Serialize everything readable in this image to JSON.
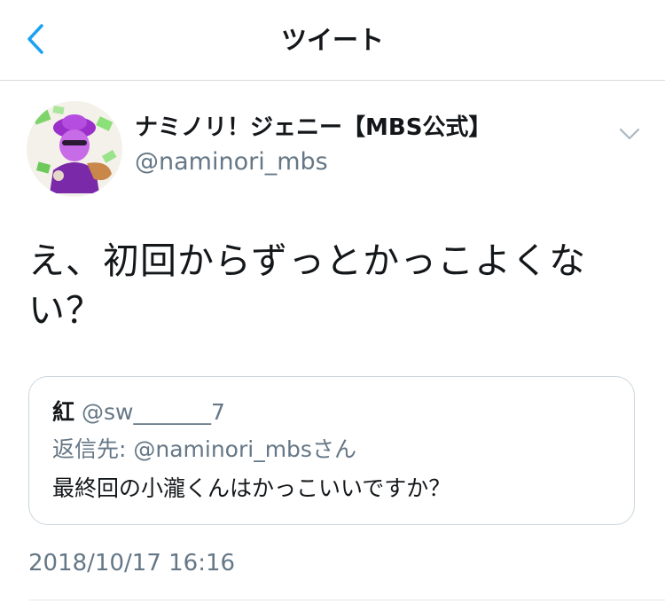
{
  "nav": {
    "title": "ツイート"
  },
  "tweet": {
    "display_name": "ナミノリ！ジェニー【MBS公式】",
    "handle": "@naminori_mbs",
    "text_line1": "え、初回からずっとかっこよくな",
    "text_line2": "い？",
    "timestamp": "2018/10/17 16:16"
  },
  "quote": {
    "name": "紅",
    "handle": "@sw_______7",
    "reply_to": "返信先: @naminori_mbsさん",
    "text": "最終回の小瀧くんはかっこいいですか？"
  },
  "icons": {
    "back": "chevron-left-icon",
    "caret": "chevron-down-icon"
  },
  "colors": {
    "accent": "#1da1f2",
    "secondary_text": "#657786",
    "border": "#ccd6dd"
  }
}
